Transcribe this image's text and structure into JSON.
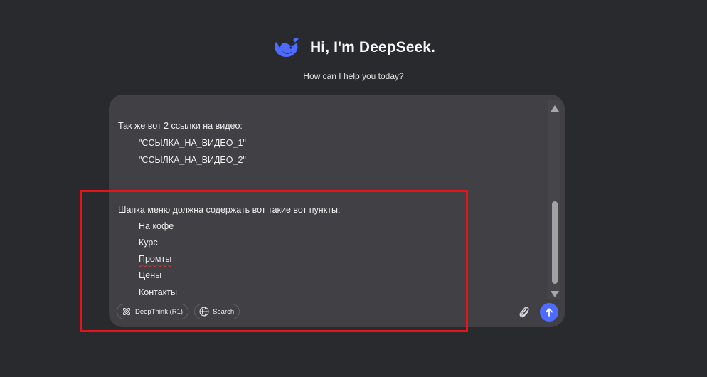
{
  "header": {
    "title": "Hi, I'm DeepSeek.",
    "subtitle": "How can I help you today?"
  },
  "composer": {
    "lines": [
      "Так же вот 2 ссылки на видео:",
      "\"ССЫЛКА_НА_ВИДЕО_1\"",
      "\"ССЫЛКА_НА_ВИДЕО_2\"",
      "Шапка меню должна содержать вот такие вот пункты:",
      "На кофе",
      "Курс",
      "Промты",
      "Цены",
      "Контакты"
    ],
    "deepthink_label": "DeepThink (R1)",
    "search_label": "Search"
  },
  "colors": {
    "background": "#292a2d",
    "composer_bg": "#404045",
    "accent": "#4d6bfe",
    "annotation": "#e8121b"
  },
  "icons": {
    "logo": "deepseek-whale-logo",
    "deepthink": "atom-icon",
    "search": "globe-icon",
    "attach": "paperclip-icon",
    "send": "arrow-up-icon"
  }
}
